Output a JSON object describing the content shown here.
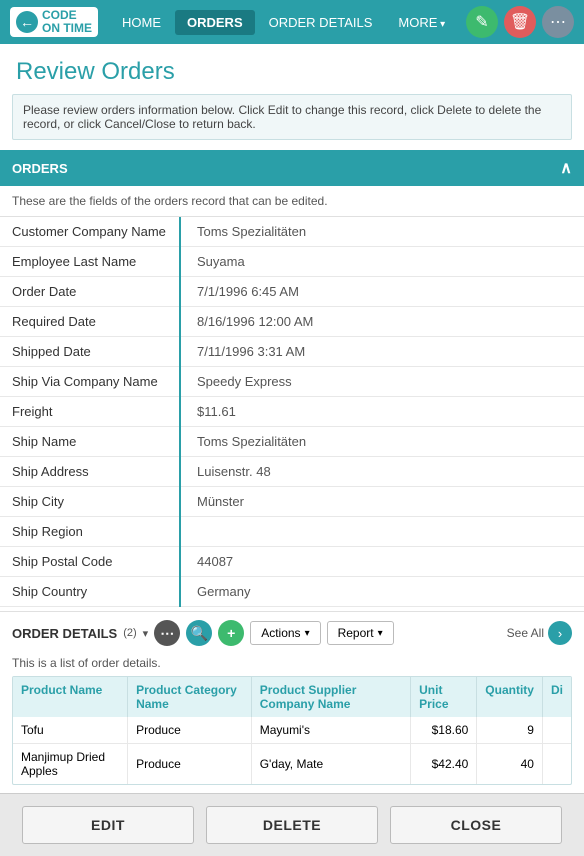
{
  "nav": {
    "logo_line1": "CODE",
    "logo_line2": "ON TIME",
    "links": [
      {
        "label": "HOME",
        "active": false
      },
      {
        "label": "ORDERS",
        "active": true
      },
      {
        "label": "ORDER DETAILS",
        "active": false
      },
      {
        "label": "MORE",
        "active": false,
        "dropdown": true
      }
    ],
    "icon_edit": "✎",
    "icon_delete": "🗑",
    "icon_more": "⋯"
  },
  "page": {
    "title": "Review Orders",
    "info_text": "Please review orders information below. Click Edit to change this record, click Delete to delete the record, or click Cancel/Close to return back."
  },
  "orders_section": {
    "title": "ORDERS",
    "note": "These are the fields of the orders record that can be edited.",
    "fields": [
      {
        "label": "Customer Company Name",
        "value": "Toms Spezialitäten"
      },
      {
        "label": "Employee Last Name",
        "value": "Suyama"
      },
      {
        "label": "Order Date",
        "value": "7/1/1996 6:45 AM"
      },
      {
        "label": "Required Date",
        "value": "8/16/1996 12:00 AM"
      },
      {
        "label": "Shipped Date",
        "value": "7/11/1996 3:31 AM"
      },
      {
        "label": "Ship Via Company Name",
        "value": "Speedy Express"
      },
      {
        "label": "Freight",
        "value": "$11.61"
      },
      {
        "label": "Ship Name",
        "value": "Toms Spezialitäten"
      },
      {
        "label": "Ship Address",
        "value": "Luisenstr. 48"
      },
      {
        "label": "Ship City",
        "value": "Münster"
      },
      {
        "label": "Ship Region",
        "value": ""
      },
      {
        "label": "Ship Postal Code",
        "value": "44087"
      },
      {
        "label": "Ship Country",
        "value": "Germany"
      }
    ]
  },
  "order_details_section": {
    "title": "ORDER DETAILS",
    "count": "(2)",
    "note": "This is a list of order details.",
    "actions_label": "Actions",
    "report_label": "Report",
    "see_all_label": "See All",
    "columns": [
      {
        "label": "Product Name"
      },
      {
        "label": "Product Category Name"
      },
      {
        "label": "Product Supplier Company Name"
      },
      {
        "label": "Unit Price"
      },
      {
        "label": "Quantity"
      },
      {
        "label": "Di"
      }
    ],
    "rows": [
      {
        "product_name": "Tofu",
        "category": "Produce",
        "supplier": "Mayumi's",
        "unit_price": "$18.60",
        "quantity": "9",
        "di": ""
      },
      {
        "product_name": "Manjimup Dried Apples",
        "category": "Produce",
        "supplier": "G'day, Mate",
        "unit_price": "$42.40",
        "quantity": "40",
        "di": ""
      }
    ]
  },
  "buttons": {
    "edit": "EDIT",
    "delete": "DELETE",
    "close": "CLOSE"
  }
}
